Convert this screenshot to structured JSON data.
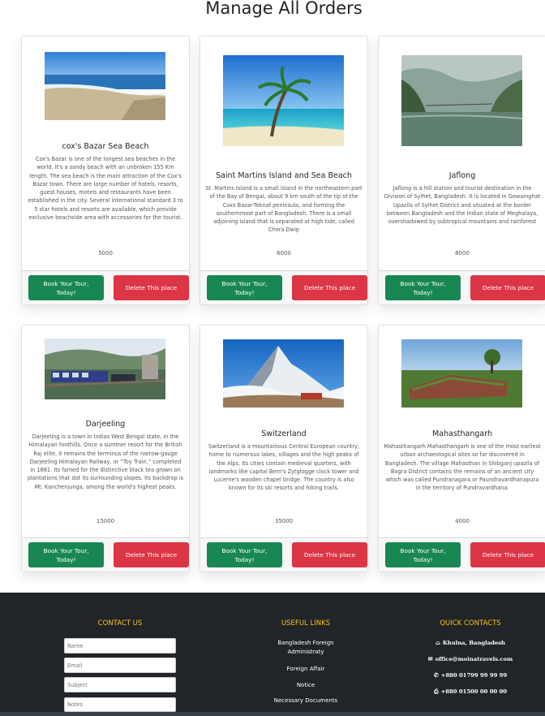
{
  "page": {
    "title": "Manage All Orders"
  },
  "cards": [
    {
      "title": "cox's Bazar Sea Beach",
      "description": "Cox's Bazar is one of the longest sea beaches in the world. It's a sandy beach with an unbroken 155 Km length. The sea beach is the main attraction of the Cox's Bazar town. There are large number of hotels, resorts, guest houses, motels and restaurants have been established in the city. Several international standard 3 to 5 star hotels and resorts are available, which provide exclusive beachside area with accessories for the tourist.",
      "price": "5000",
      "image_icon": "beach-image",
      "book_label": "Book Your Tour, Today!",
      "delete_label": "Delete This place"
    },
    {
      "title": "Saint Martins Island and Sea Beach",
      "description": "St. Martins Island is a small island in the northeastern part of the Bay of Bengal, about 9 km south of the tip of the Coxs Bazar-Teknaf peninsula, and forming the southernmost part of Bangladesh. There is a small adjoining island that is separated at high tide, called Chera Dwip",
      "price": "6000",
      "image_icon": "island-palm-image",
      "book_label": "Book Your Tour, Today!",
      "delete_label": "Delete This place"
    },
    {
      "title": "Jaflong",
      "description": "Jaflong is a hill station and tourist destination in the Division of Sylhet, Bangladesh. It is located in Gowainghat Upazila of Sylhet District and situated at the border between Bangladesh and the Indian state of Meghalaya, overshadowed by subtropical mountains and rainforest",
      "price": "8000",
      "image_icon": "river-hills-image",
      "book_label": "Book Your Tour, Today!",
      "delete_label": "Delete This place"
    },
    {
      "title": "Darjeeling",
      "description": "Darjeeling is a town in Indias West Bengal state, in the Himalayan foothills. Once a summer resort for the British Raj elite, it remains the terminus of the narrow-gauge Darjeeling Himalayan Railway, or “Toy Train,” completed in 1881. Its famed for the distinctive black tea grown on plantations that dot its surrounding slopes. Its backdrop is Mt. Kanchenjunga, among the world's highest peaks.",
      "price": "15000",
      "image_icon": "toy-train-image",
      "book_label": "Book Your Tour, Today!",
      "delete_label": "Delete This place"
    },
    {
      "title": "Switzerland",
      "description": "Switzerland is a mountainous Central European country, home to numerous lakes, villages and the high peaks of the Alps. Its cities contain medieval quarters, with landmarks like capital Bern's Zytglogge clock tower and Lucerne's wooden chapel bridge. The country is also known for its ski resorts and hiking trails.",
      "price": "35000",
      "image_icon": "matterhorn-image",
      "book_label": "Book Your Tour, Today!",
      "delete_label": "Delete This place"
    },
    {
      "title": "Mahasthangarh",
      "description": "Mahasthangarh Mahasthangarh is one of the most earliest urban archaeological sites so far discovered in Bangladesh. The village Mahasthan in Shibganj upazila of Bogra District contains the remains of an ancient city which was called Pundranagara or Paundravardhanapura in the territory of Pundravardhana.",
      "price": "4000",
      "image_icon": "ruins-field-image",
      "book_label": "Book Your Tour, Today!",
      "delete_label": "Delete This place"
    }
  ],
  "footer": {
    "contact": {
      "heading": "CONTACT US",
      "name_placeholder": "Name",
      "email_placeholder": "Email",
      "subject_placeholder": "Subject",
      "notes_placeholder": "Notes"
    },
    "links": {
      "heading": "USEFUL LINKS",
      "items": [
        "Bangladesh Foreign Administraty",
        "Foreign Affair",
        "Notice",
        "Necessary Documents"
      ]
    },
    "quick": {
      "heading": "QUICK CONTACTS",
      "address": "Khulna, Bangladesh",
      "email": "office@moinatravels.com",
      "phone": "+880 01799 99 99 99",
      "fax": "+880 01500 00 00 00",
      "icons": [
        "home-icon",
        "envelope-icon",
        "phone-icon",
        "printer-icon"
      ]
    },
    "colors": {
      "background": "#212529",
      "heading": "#ffc107"
    }
  },
  "colors": {
    "book_button": "#198754",
    "delete_button": "#dc3545"
  }
}
